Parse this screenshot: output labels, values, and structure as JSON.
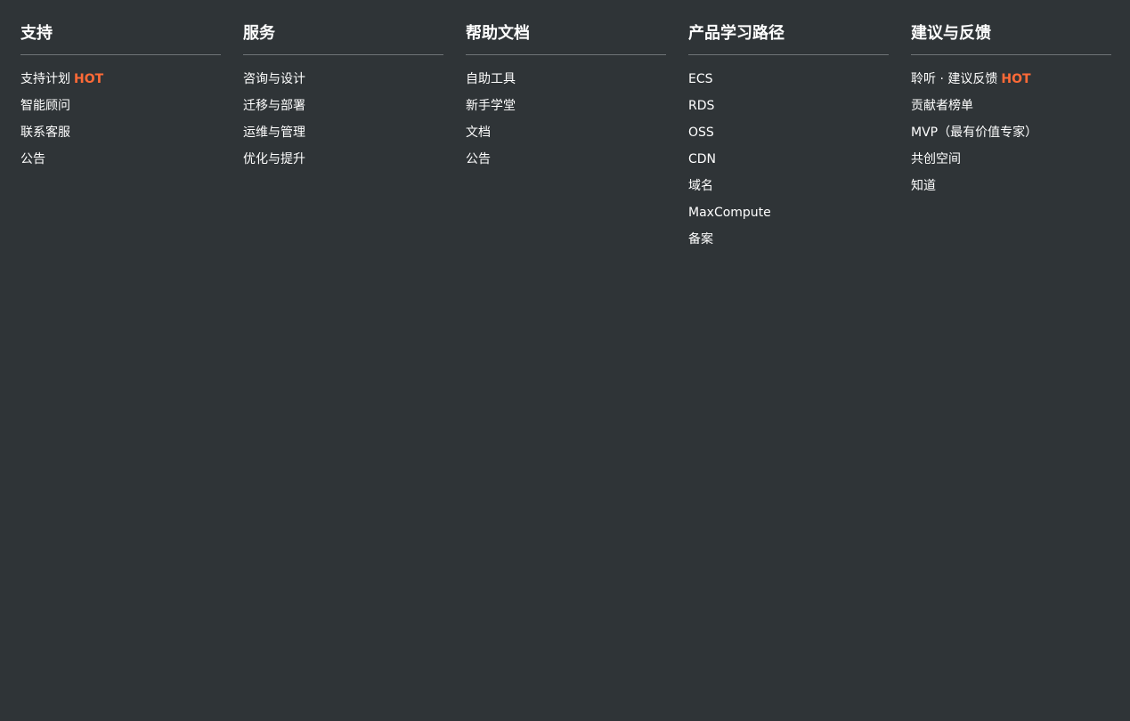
{
  "columns": [
    {
      "title": "支持",
      "items": [
        {
          "label": "支持计划",
          "badge": "HOT"
        },
        {
          "label": "智能顾问",
          "badge": ""
        },
        {
          "label": "联系客服",
          "badge": ""
        },
        {
          "label": "公告",
          "badge": ""
        }
      ]
    },
    {
      "title": "服务",
      "items": [
        {
          "label": "咨询与设计",
          "badge": ""
        },
        {
          "label": "迁移与部署",
          "badge": ""
        },
        {
          "label": "运维与管理",
          "badge": ""
        },
        {
          "label": "优化与提升",
          "badge": ""
        }
      ]
    },
    {
      "title": "帮助文档",
      "items": [
        {
          "label": "自助工具",
          "badge": ""
        },
        {
          "label": "新手学堂",
          "badge": ""
        },
        {
          "label": "文档",
          "badge": ""
        },
        {
          "label": "公告",
          "badge": ""
        }
      ]
    },
    {
      "title": "产品学习路径",
      "items": [
        {
          "label": "ECS",
          "badge": ""
        },
        {
          "label": "RDS",
          "badge": ""
        },
        {
          "label": "OSS",
          "badge": ""
        },
        {
          "label": "CDN",
          "badge": ""
        },
        {
          "label": "域名",
          "badge": ""
        },
        {
          "label": "MaxCompute",
          "badge": ""
        },
        {
          "label": "备案",
          "badge": ""
        }
      ]
    },
    {
      "title": "建议与反馈",
      "items": [
        {
          "label": "聆听 · 建议反馈",
          "badge": "HOT"
        },
        {
          "label": "贡献者榜单",
          "badge": ""
        },
        {
          "label": "MVP（最有价值专家）",
          "badge": ""
        },
        {
          "label": "共创空间",
          "badge": ""
        },
        {
          "label": "知道",
          "badge": ""
        }
      ]
    }
  ],
  "colors": {
    "background": "#2f3437",
    "text": "#ffffff",
    "hot_badge": "#ff6a37",
    "divider": "#6f7477"
  }
}
